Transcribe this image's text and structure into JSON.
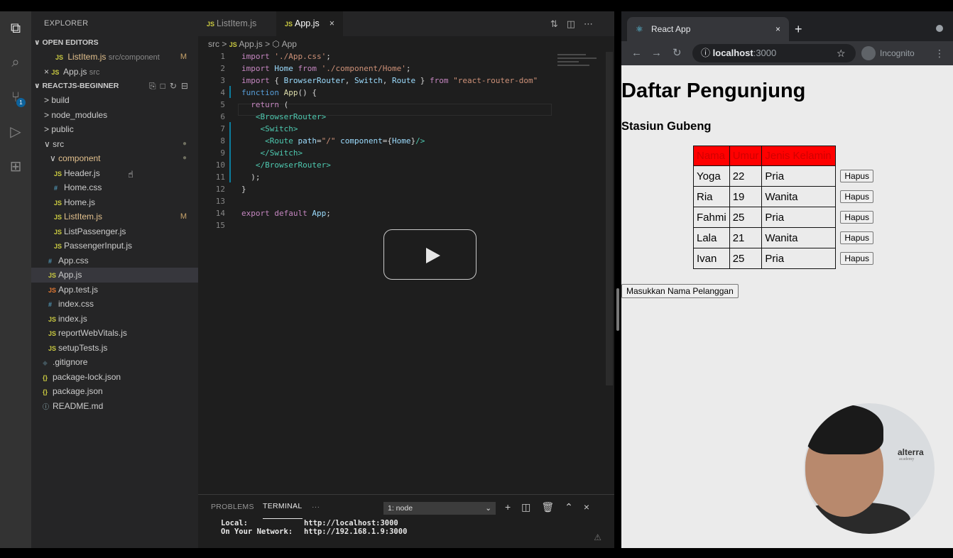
{
  "vscode": {
    "explorer_title": "EXPLORER",
    "open_editors_label": "OPEN EDITORS",
    "open_editors": [
      {
        "icon": "JS",
        "name": "ListItem.js",
        "path": "src/component",
        "status": "M"
      },
      {
        "icon": "JS",
        "name": "App.js",
        "path": "src",
        "prefix": "×"
      }
    ],
    "project_label": "REACTJS-BEGINNER",
    "tree": [
      {
        "name": "build",
        "chevron": ">"
      },
      {
        "name": "node_modules",
        "chevron": ">"
      },
      {
        "name": "public",
        "chevron": ">"
      },
      {
        "name": "src",
        "chevron": "∨"
      },
      {
        "name": "component",
        "chevron": "∨"
      },
      {
        "name": "Header.js",
        "icon": "JS"
      },
      {
        "name": "Home.css",
        "icon": "#"
      },
      {
        "name": "Home.js",
        "icon": "JS"
      },
      {
        "name": "ListItem.js",
        "icon": "JS",
        "status": "M"
      },
      {
        "name": "ListPassenger.js",
        "icon": "JS"
      },
      {
        "name": "PassengerInput.js",
        "icon": "JS"
      },
      {
        "name": "App.css",
        "icon": "#"
      },
      {
        "name": "App.js",
        "icon": "JS"
      },
      {
        "name": "App.test.js",
        "icon": "JS"
      },
      {
        "name": "index.css",
        "icon": "#"
      },
      {
        "name": "index.js",
        "icon": "JS"
      },
      {
        "name": "reportWebVitals.js",
        "icon": "JS"
      },
      {
        "name": "setupTests.js",
        "icon": "JS"
      },
      {
        "name": ".gitignore",
        "icon": "◆"
      },
      {
        "name": "package-lock.json",
        "icon": "{}"
      },
      {
        "name": "package.json",
        "icon": "{}"
      },
      {
        "name": "README.md",
        "icon": "ⓘ"
      }
    ],
    "tabs": [
      {
        "icon": "JS",
        "name": "ListItem.js"
      },
      {
        "icon": "JS",
        "name": "App.js",
        "close": "×"
      }
    ],
    "breadcrumb": {
      "folder": "src",
      "file": "App.js",
      "symbol": "App"
    },
    "line_numbers": [
      "1",
      "2",
      "3",
      "4",
      "5",
      "6",
      "7",
      "8",
      "9",
      "10",
      "11",
      "12",
      "13",
      "14",
      "15"
    ],
    "panel": {
      "tabs": [
        "PROBLEMS",
        "TERMINAL",
        "···"
      ],
      "terminal_select": "1: node",
      "terminal_lines": [
        {
          "label": "Local:",
          "value": "http://localhost:3000"
        },
        {
          "label": "On Your Network:",
          "value": "http://192.168.1.9:3000"
        }
      ]
    }
  },
  "browser": {
    "tab_title": "React App",
    "url_host": "localhost",
    "url_port": ":3000",
    "profile": "Incognito",
    "page": {
      "title": "Daftar Pengunjung",
      "subtitle": "Stasiun Gubeng",
      "columns": [
        "Nama",
        "Umur",
        "Jenis Kelamin"
      ],
      "rows": [
        {
          "nama": "Yoga",
          "umur": "22",
          "jk": "Pria",
          "action": "Hapus"
        },
        {
          "nama": "Ria",
          "umur": "19",
          "jk": "Wanita",
          "action": "Hapus"
        },
        {
          "nama": "Fahmi",
          "umur": "25",
          "jk": "Pria",
          "action": "Hapus"
        },
        {
          "nama": "Lala",
          "umur": "21",
          "jk": "Wanita",
          "action": "Hapus"
        },
        {
          "nama": "Ivan",
          "umur": "25",
          "jk": "Pria",
          "action": "Hapus"
        }
      ],
      "add_button": "Masukkan Nama Pelanggan"
    },
    "webcam_logo": "alterra",
    "webcam_logo_sub": "academy"
  }
}
